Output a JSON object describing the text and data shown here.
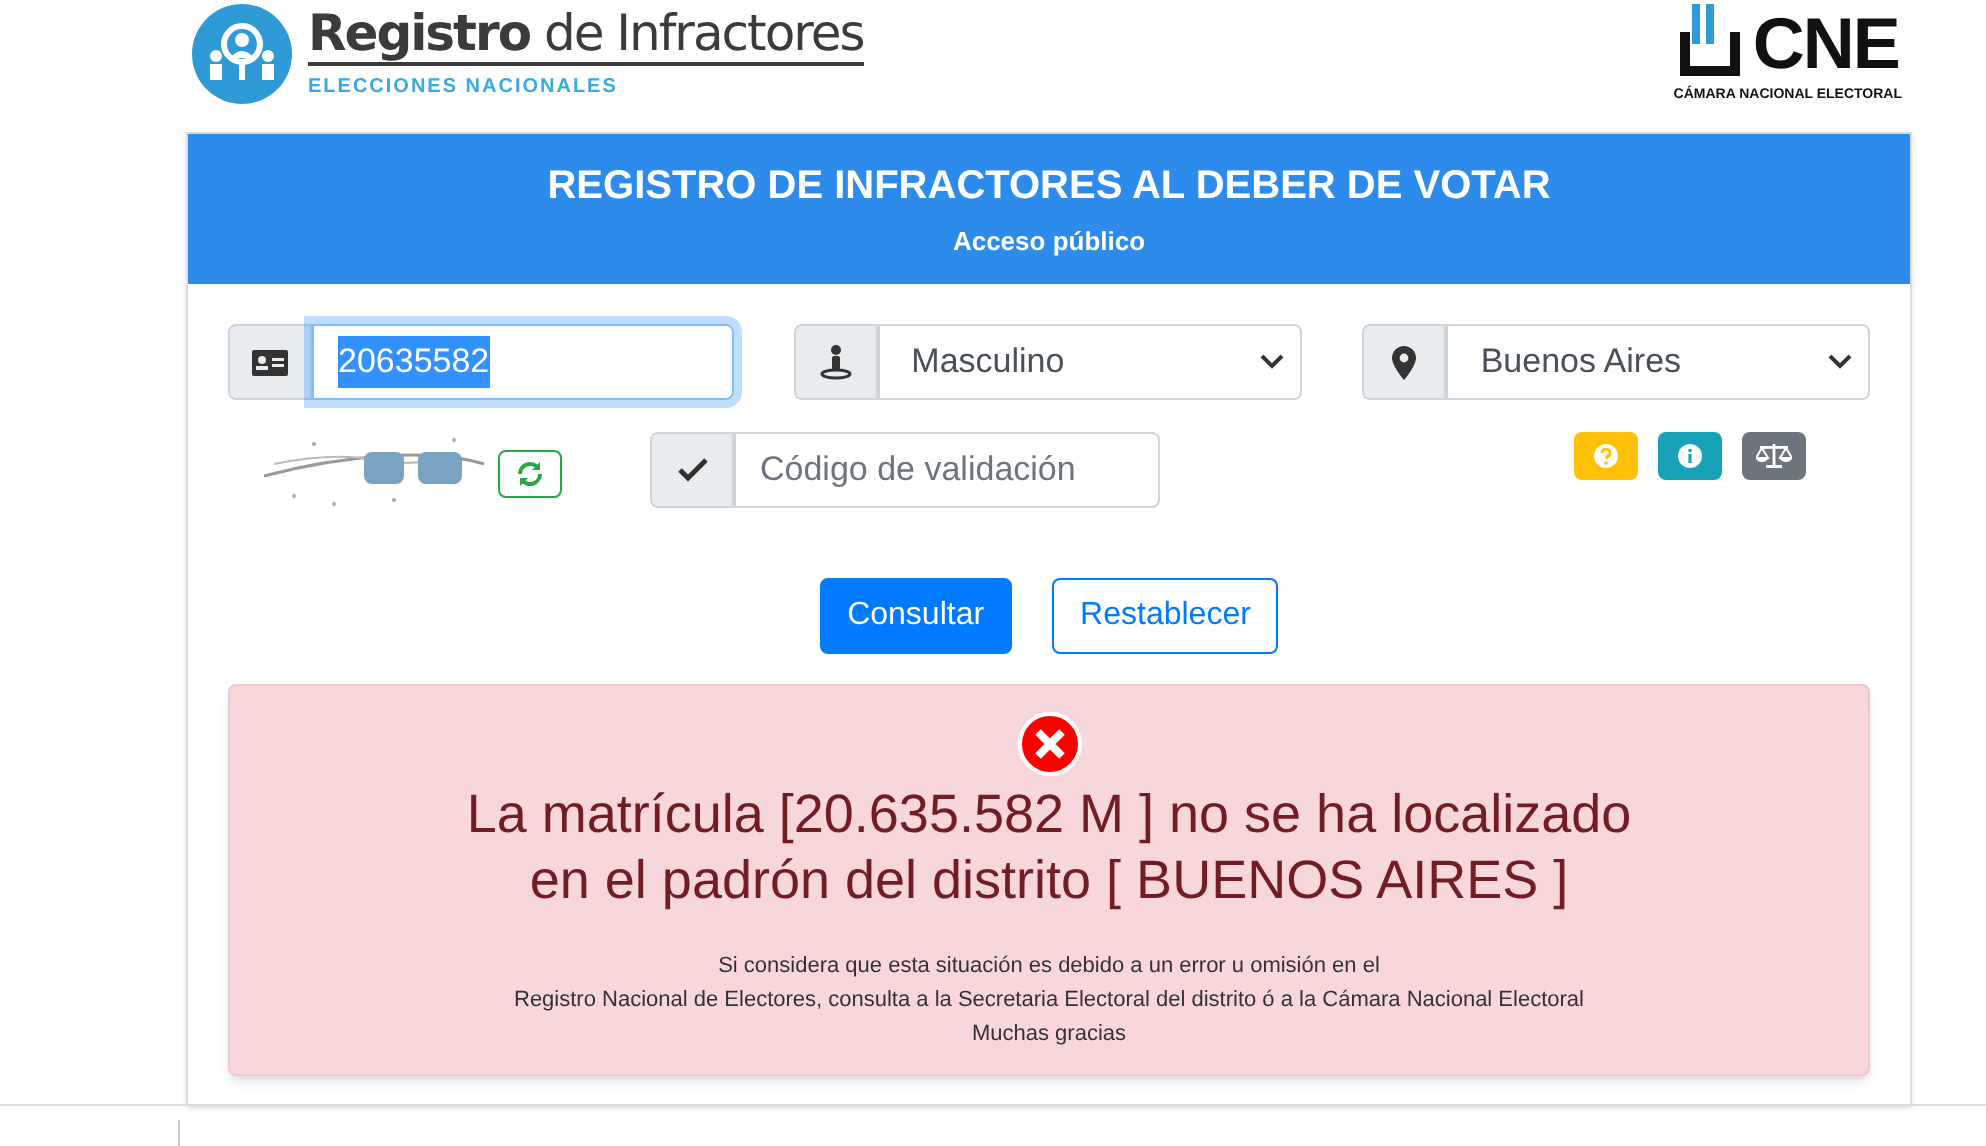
{
  "header": {
    "logo": {
      "title": "**Registro** de Infractores",
      "subtitle": "ELECCIONES NACIONALES"
    },
    "cne": {
      "title": "CNE",
      "subtitle": "CÁMARA NACIONAL ELECTORAL"
    }
  },
  "card": {
    "title": "REGISTRO DE INFRACTORES AL DEBER DE VOTAR",
    "subtitle": "Acceso público"
  },
  "form": {
    "document": {
      "value": "20635582",
      "text_selected": true,
      "focused": true
    },
    "sex": {
      "value": "Masculino"
    },
    "district": {
      "value": "Buenos Aires"
    },
    "code": {
      "placeholder": "Código de validación"
    },
    "help_buttons": [
      {
        "kind": "help",
        "color": "#ffc107"
      },
      {
        "kind": "info",
        "color": "#17a2b8"
      },
      {
        "kind": "legal",
        "color": "#6c757d"
      }
    ],
    "buttons": [
      {
        "label": "Consultar",
        "primary": true
      },
      {
        "label": "Restablecer",
        "primary": false
      }
    ]
  },
  "alert": {
    "message": "La matrícula [20.635.582 M ] no se ha localizado",
    "message_2": "en el padrón del distrito [ BUENOS AIRES ]",
    "note": [
      "Si considera que esta situación es debido a un error u omisión en el",
      "Registro Nacional de Electores, consulta a la Secretaria Electoral del distrito ó a la Cámara Nacional Electoral",
      "Muchas gracias"
    ]
  }
}
